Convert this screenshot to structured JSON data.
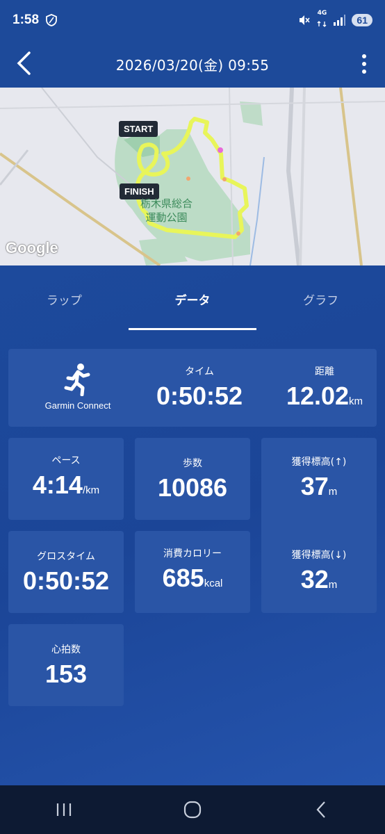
{
  "status_bar": {
    "time": "1:58",
    "network": "4G",
    "battery": "61"
  },
  "header": {
    "title": "2026/03/20(金) 09:55"
  },
  "map": {
    "start_label": "START",
    "finish_label": "FINISH",
    "park_label_line1": "栃木県総合",
    "park_label_line2": "運動公園",
    "attribution": "Google"
  },
  "tabs": [
    {
      "label": "ラップ",
      "active": false
    },
    {
      "label": "データ",
      "active": true
    },
    {
      "label": "グラフ",
      "active": false
    }
  ],
  "summary": {
    "source_label": "Garmin Connect",
    "time_label": "タイム",
    "time_value": "0:50:52",
    "distance_label": "距離",
    "distance_value": "12.02",
    "distance_unit": "km"
  },
  "stats": {
    "pace_label": "ペース",
    "pace_value": "4:14",
    "pace_unit": "/km",
    "steps_label": "歩数",
    "steps_value": "10086",
    "gain_label": "獲得標高(↑)",
    "gain_value": "37",
    "gain_unit": "m",
    "gross_label": "グロスタイム",
    "gross_value": "0:50:52",
    "calories_label": "消費カロリー",
    "calories_value": "685",
    "calories_unit": "kcal",
    "loss_label": "獲得標高(↓)",
    "loss_value": "32",
    "loss_unit": "m",
    "hr_label": "心拍数",
    "hr_value": "153"
  },
  "colors": {
    "header_bg": "#1d4a9a",
    "card_bg": "#2a55a6",
    "route": "#e8f55a"
  }
}
